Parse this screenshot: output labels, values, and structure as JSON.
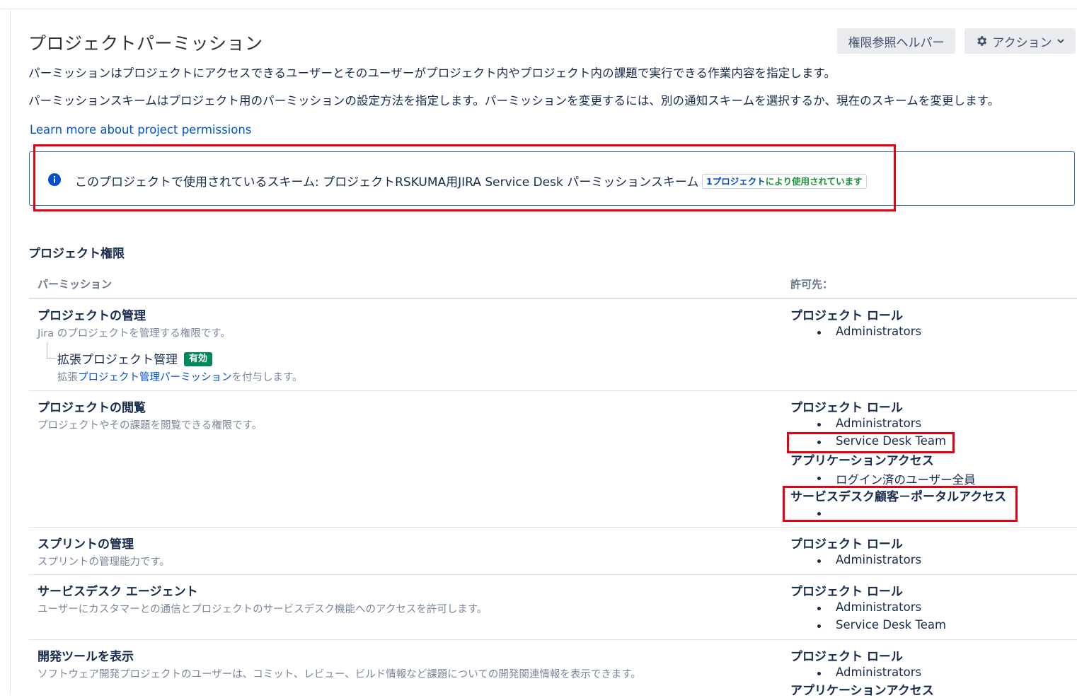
{
  "page": {
    "title": "プロジェクトパーミッション",
    "description_1": "パーミッションはプロジェクトにアクセスできるユーザーとそのユーザーがプロジェクト内やプロジェクト内の課題で実行できる作業内容を指定します。",
    "description_2": "パーミッションスキームはプロジェクト用のパーミッションの設定方法を指定します。パーミッションを変更するには、別の通知スキームを選択するか、現在のスキームを変更します。",
    "learn_more_link": "Learn more about project permissions"
  },
  "toolbar": {
    "helper_button": "権限参照ヘルパー",
    "actions_button": "アクション",
    "actions_icon": "gear-icon",
    "actions_caret_icon": "chevron-down-icon"
  },
  "scheme_info": {
    "icon": "info-icon",
    "text": "このプロジェクトで使用されているスキーム: プロジェクトRSKUMA用JIRA Service Desk パーミッションスキーム",
    "usage_count": "1プロジェクト",
    "usage_suffix": "により使用されています"
  },
  "permissions_section": {
    "title": "プロジェクト権限",
    "column_permission": "パーミッション",
    "column_granted_to": "許可先："
  },
  "permissions": [
    {
      "name": "プロジェクトの管理",
      "description": "Jira のプロジェクトを管理する権限です。",
      "sub": {
        "name": "拡張プロジェクト管理",
        "status": "有効",
        "desc_prefix": "拡張",
        "desc_link": "プロジェクト管理パーミッション",
        "desc_suffix": "を付与します。"
      },
      "grants": [
        {
          "type": "プロジェクト ロール",
          "items": [
            "Administrators"
          ]
        }
      ]
    },
    {
      "name": "プロジェクトの閲覧",
      "description": "プロジェクトやその課題を閲覧できる権限です。",
      "grants": [
        {
          "type": "プロジェクト ロール",
          "items": [
            "Administrators",
            "Service Desk Team"
          ]
        },
        {
          "type": "アプリケーションアクセス",
          "items": [
            "ログイン済のユーザー全員"
          ]
        },
        {
          "type": "サービスデスク顧客－ポータルアクセス",
          "items": [
            ""
          ]
        }
      ]
    },
    {
      "name": "スプリントの管理",
      "description": "スプリントの管理能力です。",
      "grants": [
        {
          "type": "プロジェクト ロール",
          "items": [
            "Administrators"
          ]
        }
      ]
    },
    {
      "name": "サービスデスク エージェント",
      "description": "ユーザーにカスタマーとの通信とプロジェクトのサービスデスク機能へのアクセスを許可します。",
      "grants": [
        {
          "type": "プロジェクト ロール",
          "items": [
            "Administrators",
            "Service Desk Team"
          ]
        }
      ]
    },
    {
      "name": "開発ツールを表示",
      "description": "ソフトウェア開発プロジェクトのユーザーは、コミット、レビュー、ビルド情報など課題についての開発関連情報を表示できます。",
      "grants": [
        {
          "type": "プロジェクト ロール",
          "items": [
            "Administrators"
          ]
        },
        {
          "type": "アプリケーションアクセス",
          "items": []
        }
      ]
    }
  ],
  "colors": {
    "link": "#0052cc",
    "enabled_lozenge": "#00875a",
    "highlight": "#e60012",
    "info_border": "#3a6ea5"
  }
}
